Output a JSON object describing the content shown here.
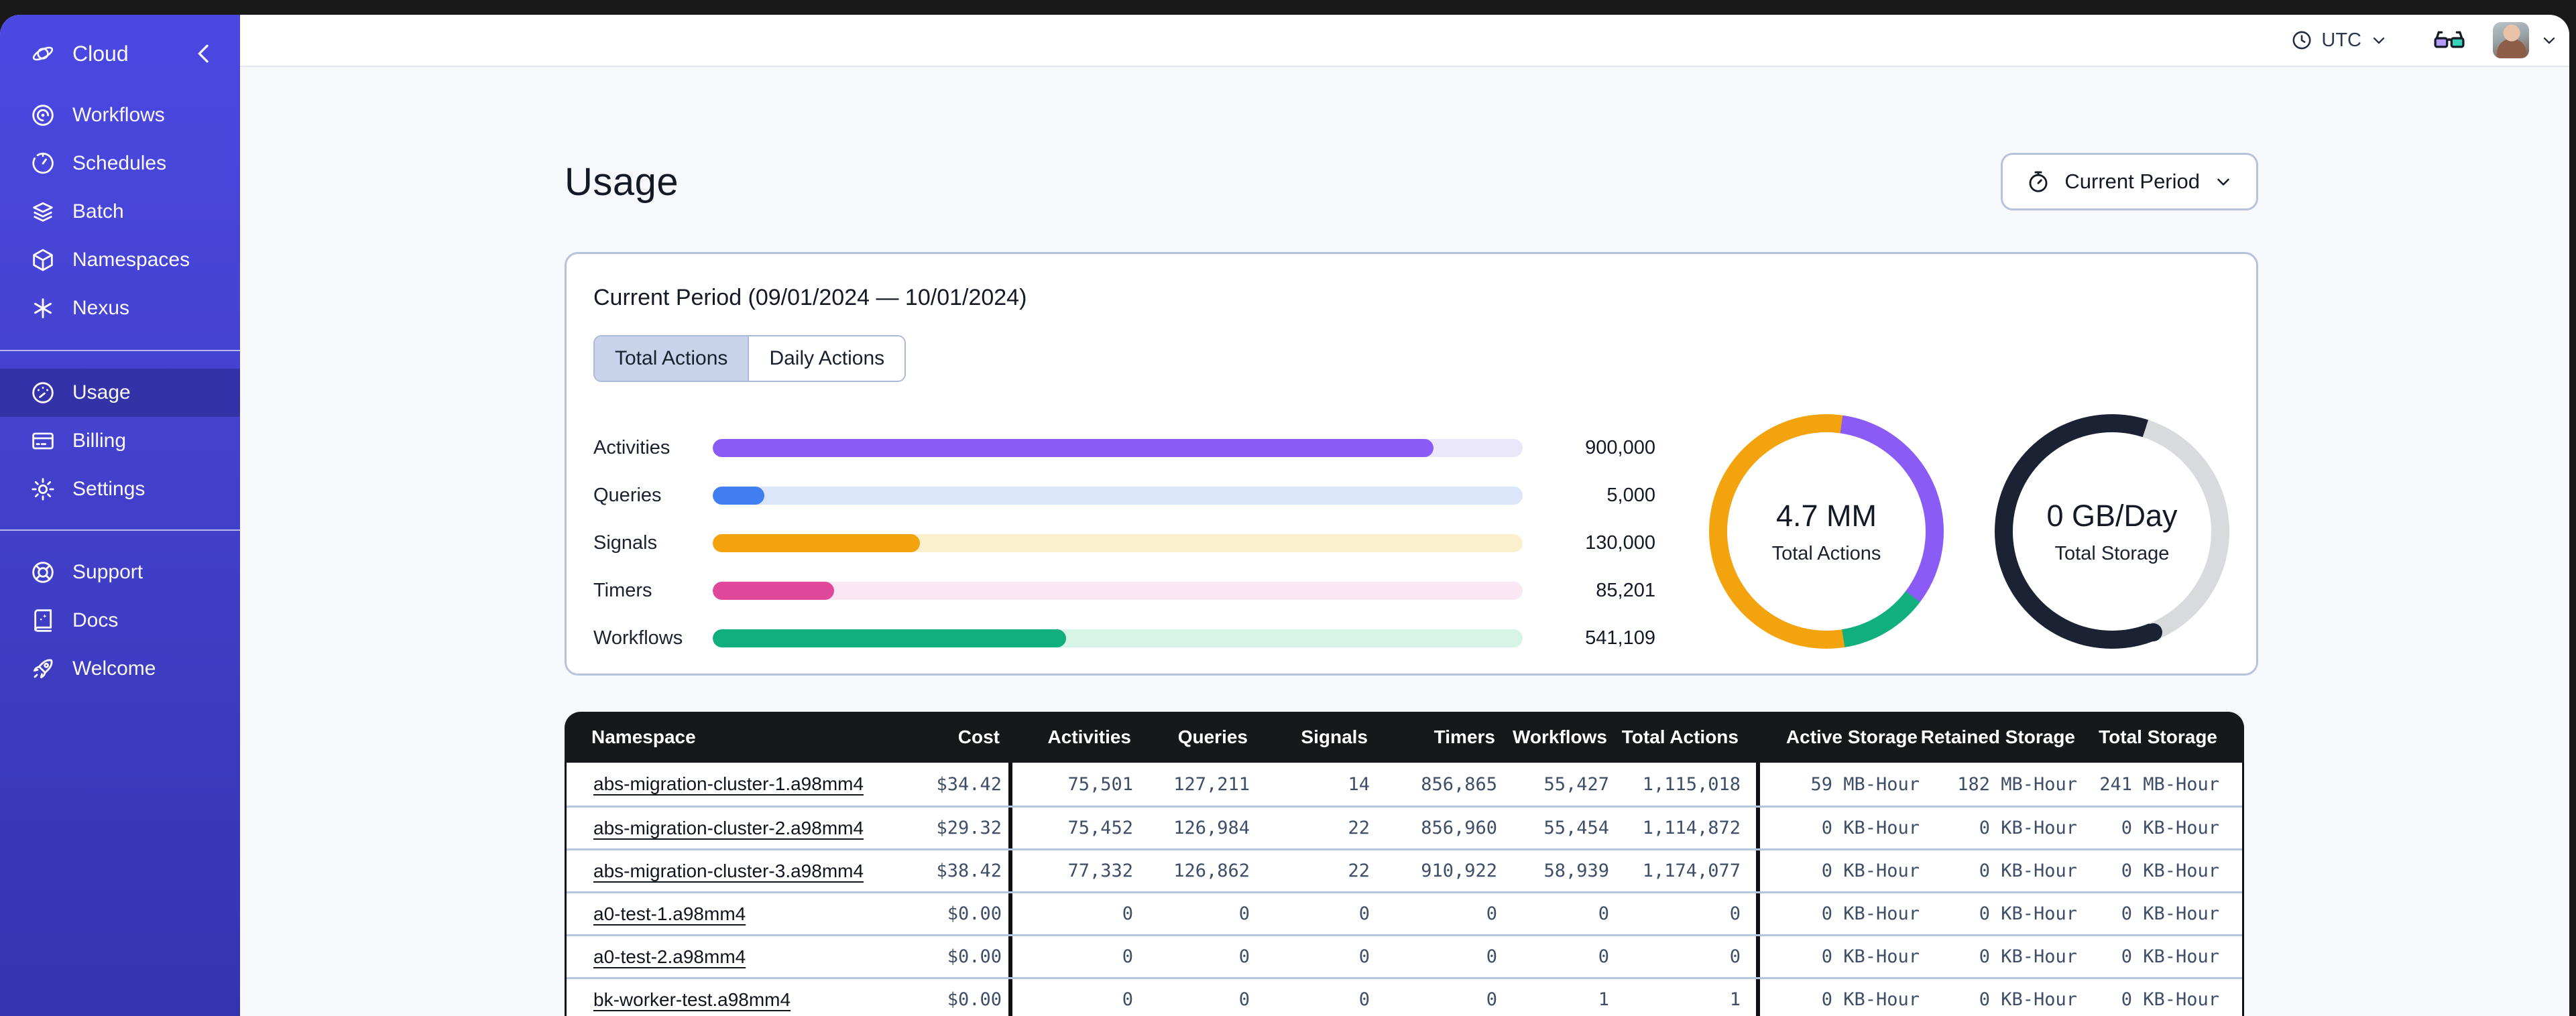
{
  "sidebar": {
    "brand": {
      "label": "Cloud"
    },
    "items": [
      {
        "label": "Workflows"
      },
      {
        "label": "Schedules"
      },
      {
        "label": "Batch"
      },
      {
        "label": "Namespaces"
      },
      {
        "label": "Nexus"
      }
    ],
    "account_items": [
      {
        "label": "Usage",
        "active": true
      },
      {
        "label": "Billing"
      },
      {
        "label": "Settings"
      }
    ],
    "footer_items": [
      {
        "label": "Support"
      },
      {
        "label": "Docs"
      },
      {
        "label": "Welcome"
      }
    ]
  },
  "topbar": {
    "timezone": "UTC"
  },
  "page": {
    "title": "Usage",
    "period_button_label": "Current Period"
  },
  "summary": {
    "title": "Current Period (09/01/2024 — 10/01/2024)",
    "tabs": [
      "Total Actions",
      "Daily Actions"
    ],
    "active_tab": "Total Actions"
  },
  "colors": {
    "sidebar_top": "#4B48E2",
    "sidebar_bottom": "#3434AF",
    "table_header_bg": "#17181C",
    "card_border": "#B7C3DC",
    "tab_selected_bg": "#C9D4EB",
    "numeric_text": "#3E4E68",
    "content_bg": "#F6F8FB"
  },
  "chart_data": [
    {
      "type": "bar",
      "orientation": "horizontal",
      "categories": [
        "Activities",
        "Queries",
        "Signals",
        "Timers",
        "Workflows"
      ],
      "values": [
        900000,
        5000,
        130000,
        85201,
        541109
      ],
      "value_labels": [
        "900,000",
        "5,000",
        "130,000",
        "85,201",
        "541,109"
      ],
      "percents": [
        89,
        6.4,
        25.6,
        15,
        43.6
      ],
      "colors": [
        "#8A5CF5",
        "#3F7FF2",
        "#F2A30D",
        "#E0489B",
        "#12AF7E"
      ],
      "track_colors": [
        "#EBE7FB",
        "#DBE6FA",
        "#FBF0CD",
        "#FBE6F3",
        "#D7F5E7"
      ]
    },
    {
      "type": "donut",
      "label": "4.7 MM",
      "sublabel": "Total Actions",
      "segments": [
        {
          "color": "#F2A30D",
          "start": 0,
          "end": 8
        },
        {
          "color": "#8A5CF5",
          "start": 8,
          "end": 127
        },
        {
          "color": "#12AF7E",
          "start": 127,
          "end": 171
        },
        {
          "color": "#F2A30D",
          "start": 171,
          "end": 360
        }
      ]
    },
    {
      "type": "donut",
      "label": "0 GB/Day",
      "sublabel": "Total Storage",
      "segments": [
        {
          "color": "#1B2234",
          "start": 0,
          "end": 18
        },
        {
          "color": "#D8DADE",
          "start": 18,
          "end": 158
        },
        {
          "color": "#1B2234",
          "start": 158,
          "end": 360
        }
      ],
      "cap_color": "#1B2234"
    }
  ],
  "table": {
    "columns": [
      "Namespace",
      "Cost",
      "Activities",
      "Queries",
      "Signals",
      "Timers",
      "Workflows",
      "Total Actions",
      "Active Storage",
      "Retained Storage",
      "Total Storage"
    ],
    "rows": [
      {
        "namespace": "abs-migration-cluster-1.a98mm4",
        "cost": "$34.42",
        "activities": "75,501",
        "queries": "127,211",
        "signals": "14",
        "timers": "856,865",
        "workflows": "55,427",
        "total_actions": "1,115,018",
        "active_storage": "59 MB-Hour",
        "retained_storage": "182 MB-Hour",
        "total_storage": "241 MB-Hour"
      },
      {
        "namespace": "abs-migration-cluster-2.a98mm4",
        "cost": "$29.32",
        "activities": "75,452",
        "queries": "126,984",
        "signals": "22",
        "timers": "856,960",
        "workflows": "55,454",
        "total_actions": "1,114,872",
        "active_storage": "0 KB-Hour",
        "retained_storage": "0 KB-Hour",
        "total_storage": "0 KB-Hour"
      },
      {
        "namespace": "abs-migration-cluster-3.a98mm4",
        "cost": "$38.42",
        "activities": "77,332",
        "queries": "126,862",
        "signals": "22",
        "timers": "910,922",
        "workflows": "58,939",
        "total_actions": "1,174,077",
        "active_storage": "0 KB-Hour",
        "retained_storage": "0 KB-Hour",
        "total_storage": "0 KB-Hour"
      },
      {
        "namespace": "a0-test-1.a98mm4",
        "cost": "$0.00",
        "activities": "0",
        "queries": "0",
        "signals": "0",
        "timers": "0",
        "workflows": "0",
        "total_actions": "0",
        "active_storage": "0 KB-Hour",
        "retained_storage": "0 KB-Hour",
        "total_storage": "0 KB-Hour"
      },
      {
        "namespace": "a0-test-2.a98mm4",
        "cost": "$0.00",
        "activities": "0",
        "queries": "0",
        "signals": "0",
        "timers": "0",
        "workflows": "0",
        "total_actions": "0",
        "active_storage": "0 KB-Hour",
        "retained_storage": "0 KB-Hour",
        "total_storage": "0 KB-Hour"
      },
      {
        "namespace": "bk-worker-test.a98mm4",
        "cost": "$0.00",
        "activities": "0",
        "queries": "0",
        "signals": "0",
        "timers": "0",
        "workflows": "1",
        "total_actions": "1",
        "active_storage": "0 KB-Hour",
        "retained_storage": "0 KB-Hour",
        "total_storage": "0 KB-Hour"
      }
    ]
  }
}
